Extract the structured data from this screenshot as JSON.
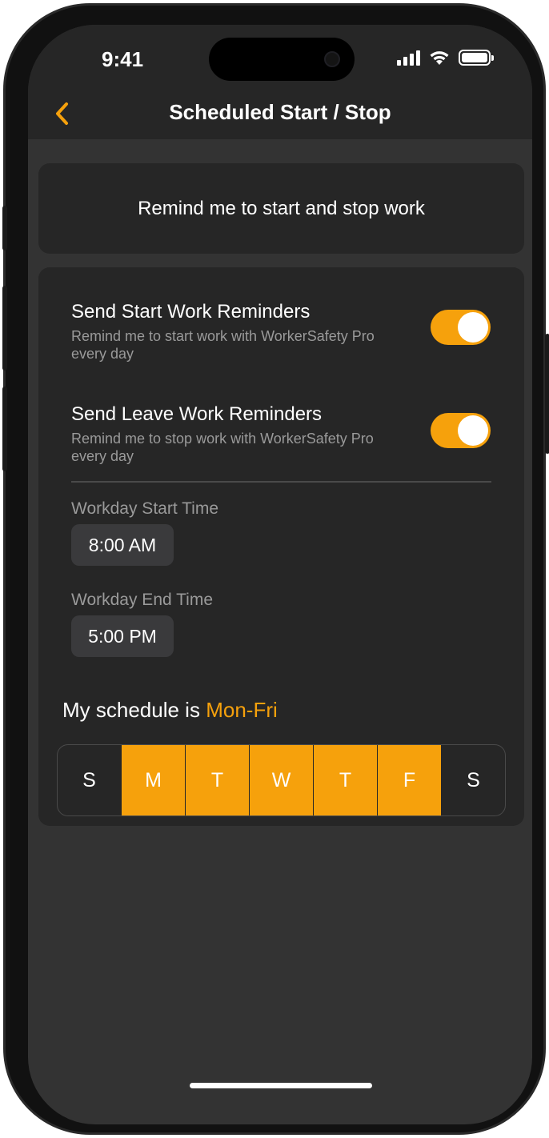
{
  "status_bar": {
    "time": "9:41"
  },
  "nav": {
    "title": "Scheduled Start / Stop",
    "back_icon": "chevron-left-icon"
  },
  "banner": {
    "text": "Remind me to start and stop work"
  },
  "reminders": {
    "start": {
      "title": "Send Start Work Reminders",
      "subtitle": "Remind me to start work with WorkerSafety Pro every day",
      "enabled": true
    },
    "leave": {
      "title": "Send Leave Work Reminders",
      "subtitle": "Remind me to stop work with WorkerSafety Pro every day",
      "enabled": true
    }
  },
  "workday": {
    "start_label": "Workday Start Time",
    "start_value": "8:00 AM",
    "end_label": "Workday End Time",
    "end_value": "5:00 PM"
  },
  "schedule": {
    "prefix": "My schedule is",
    "value": "Mon-Fri",
    "days": [
      {
        "label": "S",
        "selected": false
      },
      {
        "label": "M",
        "selected": true
      },
      {
        "label": "T",
        "selected": true
      },
      {
        "label": "W",
        "selected": true
      },
      {
        "label": "T",
        "selected": true
      },
      {
        "label": "F",
        "selected": true
      },
      {
        "label": "S",
        "selected": false
      }
    ]
  },
  "colors": {
    "accent": "#f6a10c",
    "background": "#333333",
    "card": "#262626"
  }
}
